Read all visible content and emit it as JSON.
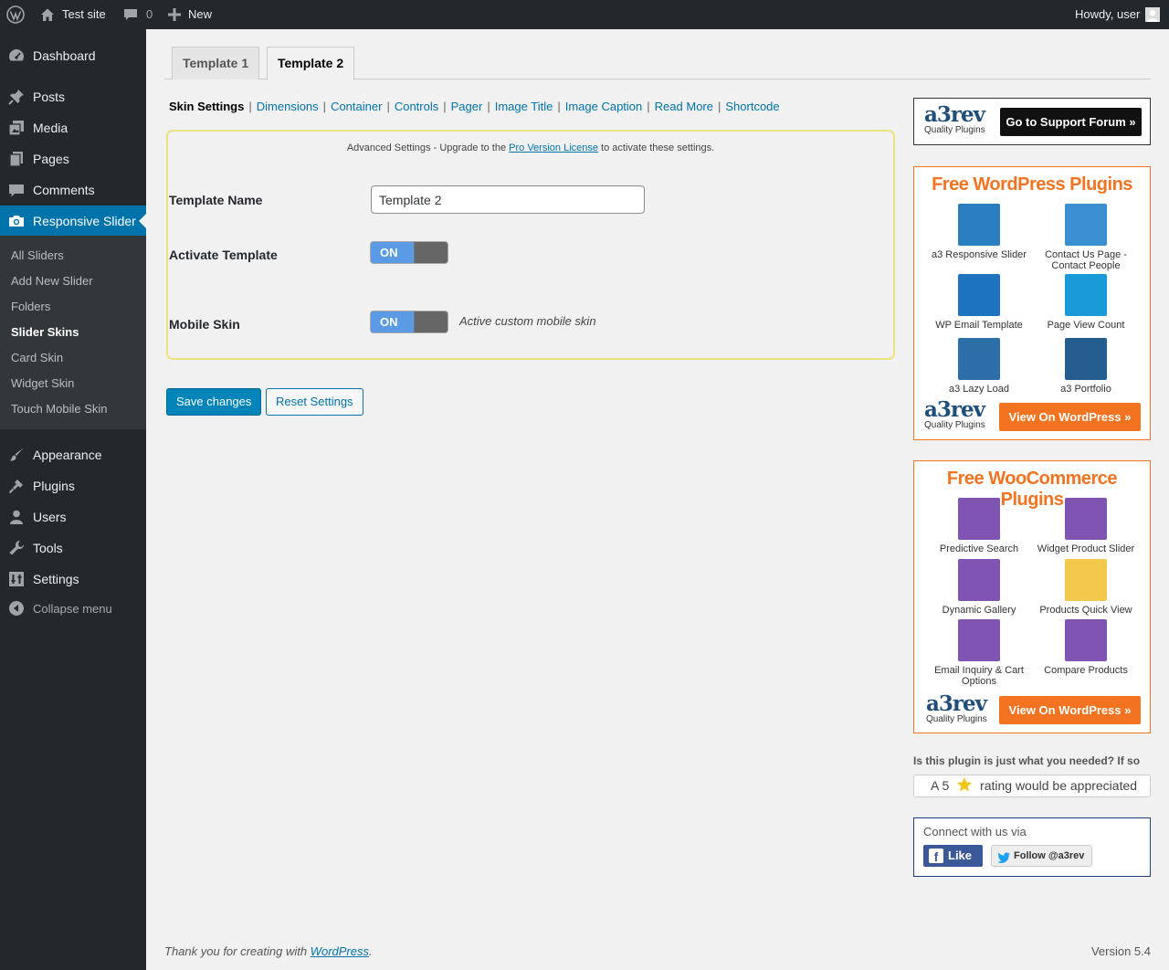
{
  "adminbar": {
    "site_name": "Test site",
    "comments_count": "0",
    "new_label": "New",
    "greeting": "Howdy, user"
  },
  "menu": {
    "items": [
      {
        "label": "Dashboard",
        "icon": "dashboard-icon"
      },
      {
        "label": "Posts",
        "icon": "pin-icon"
      },
      {
        "label": "Media",
        "icon": "media-icon"
      },
      {
        "label": "Pages",
        "icon": "pages-icon"
      },
      {
        "label": "Comments",
        "icon": "comment-icon"
      },
      {
        "label": "Responsive Slider",
        "icon": "camera-icon"
      },
      {
        "label": "Appearance",
        "icon": "brush-icon"
      },
      {
        "label": "Plugins",
        "icon": "plug-icon"
      },
      {
        "label": "Users",
        "icon": "user-icon"
      },
      {
        "label": "Tools",
        "icon": "wrench-icon"
      },
      {
        "label": "Settings",
        "icon": "settings-icon"
      }
    ],
    "collapse_label": "Collapse menu",
    "submenu": [
      "All Sliders",
      "Add New Slider",
      "Folders",
      "Slider Skins",
      "Card Skin",
      "Widget Skin",
      "Touch Mobile Skin"
    ]
  },
  "tabs": [
    "Template 1",
    "Template 2"
  ],
  "subnav": [
    "Skin Settings",
    "Dimensions",
    "Container",
    "Controls",
    "Pager",
    "Image Title",
    "Image Caption",
    "Read More",
    "Shortcode"
  ],
  "panel": {
    "notice_before": "Advanced Settings - Upgrade to the ",
    "notice_link": "Pro Version License",
    "notice_after": " to activate these settings.",
    "template_name_label": "Template Name",
    "template_name_value": "Template 2",
    "activate_label": "Activate Template",
    "activate_toggle": "ON",
    "mobile_label": "Mobile Skin",
    "mobile_toggle": "ON",
    "mobile_desc": "Active custom mobile skin"
  },
  "buttons": {
    "save": "Save changes",
    "reset": "Reset Settings"
  },
  "sidebar": {
    "logo_text": "a3rev",
    "logo_sub": "Quality Plugins",
    "support_button": "Go to Support Forum »",
    "wp_title": "Free WordPress Plugins",
    "wp_plugins": [
      "a3 Responsive Slider",
      "Contact Us Page - Contact People",
      "WP Email Template",
      "Page View Count",
      "a3 Lazy Load",
      "a3 Portfolio"
    ],
    "view_button": "View On WordPress »",
    "woo_title": "Free WooCommerce Plugins",
    "woo_plugins": [
      "Predictive Search",
      "Widget Product Slider",
      "Dynamic Gallery",
      "Products Quick View",
      "Email Inquiry & Cart Options",
      "Compare Products"
    ],
    "rate_question": "Is this plugin is just what you needed? If so",
    "rate_before": "A 5",
    "rate_after": "rating would be appreciated",
    "connect_title": "Connect with us via",
    "fb_label": "Like",
    "tw_label": "Follow @a3rev"
  },
  "footer": {
    "thanks_before": "Thank you for creating with ",
    "thanks_link": "WordPress",
    "thanks_after": ".",
    "version": "Version 5.4"
  },
  "colors": {
    "accent": "#0073aa",
    "brand_orange": "#f37321",
    "admin_dark": "#23282d"
  }
}
